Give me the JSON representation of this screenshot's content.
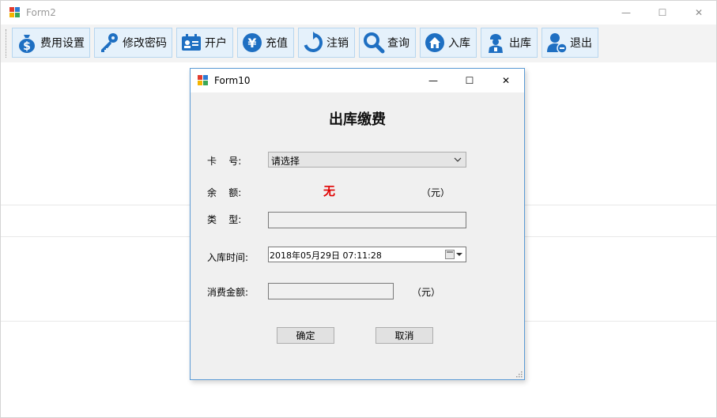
{
  "main_window": {
    "title": "Form2",
    "controls": {
      "minimize": "—",
      "maximize": "☐",
      "close": "✕"
    }
  },
  "toolbar": {
    "buttons": [
      {
        "label": "费用设置",
        "icon": "money-bag-icon"
      },
      {
        "label": "修改密码",
        "icon": "key-icon"
      },
      {
        "label": "开户",
        "icon": "id-card-icon"
      },
      {
        "label": "充值",
        "icon": "yen-icon"
      },
      {
        "label": "注销",
        "icon": "refresh-icon"
      },
      {
        "label": "查询",
        "icon": "search-icon"
      },
      {
        "label": "入库",
        "icon": "home-icon"
      },
      {
        "label": "出库",
        "icon": "worker-icon"
      },
      {
        "label": "退出",
        "icon": "user-exit-icon"
      }
    ]
  },
  "dialog": {
    "title": "Form10",
    "controls": {
      "minimize": "—",
      "maximize": "☐",
      "close": "✕"
    },
    "heading": "出库缴费",
    "card_label": "卡    号:",
    "card_value": "请选择",
    "balance_label": "余    额:",
    "balance_value": "无",
    "balance_unit": "（元）",
    "type_label": "类    型:",
    "type_value": "",
    "checkin_label": "入库时间:",
    "checkin_value": "2018年05月29日  07:11:28",
    "amount_label": "消费金额:",
    "amount_value": "",
    "amount_unit": "（元）",
    "ok_label": "确定",
    "cancel_label": "取消"
  },
  "colors": {
    "accent_border": "#5b9bd5",
    "balance_text": "#e00000",
    "toolbar_button_bg": "#e5f1fb",
    "icon_blue": "#1e6fc2"
  }
}
